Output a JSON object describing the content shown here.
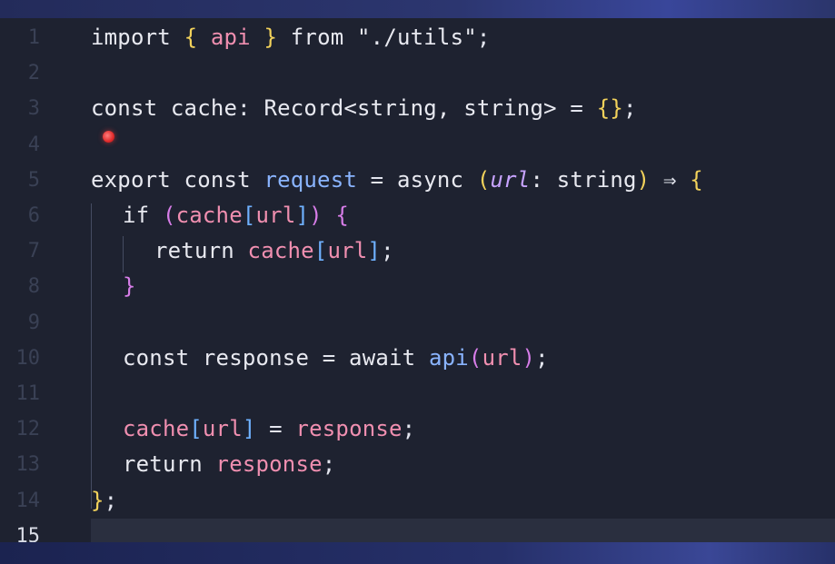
{
  "editor": {
    "current_line": "15",
    "lines": [
      {
        "number": "1",
        "tokens": [
          {
            "t": "import",
            "c": "kw"
          },
          {
            "t": " ",
            "c": "punct"
          },
          {
            "t": "{",
            "c": "bracket-y"
          },
          {
            "t": " api ",
            "c": "var"
          },
          {
            "t": "}",
            "c": "bracket-y"
          },
          {
            "t": " from ",
            "c": "kw"
          },
          {
            "t": "\"./utils\"",
            "c": "str"
          },
          {
            "t": ";",
            "c": "punct"
          }
        ]
      },
      {
        "number": "2",
        "tokens": []
      },
      {
        "number": "3",
        "tokens": [
          {
            "t": "const cache",
            "c": "kw"
          },
          {
            "t": ": ",
            "c": "punct"
          },
          {
            "t": "Record",
            "c": "type"
          },
          {
            "t": "<string, string>",
            "c": "type"
          },
          {
            "t": " = ",
            "c": "op"
          },
          {
            "t": "{}",
            "c": "bracket-y"
          },
          {
            "t": ";",
            "c": "punct"
          }
        ]
      },
      {
        "number": "4",
        "tokens": []
      },
      {
        "number": "5",
        "tokens": [
          {
            "t": "export const ",
            "c": "kw"
          },
          {
            "t": "request",
            "c": "fn"
          },
          {
            "t": " = ",
            "c": "op"
          },
          {
            "t": "async ",
            "c": "kw"
          },
          {
            "t": "(",
            "c": "bracket-y"
          },
          {
            "t": "url",
            "c": "param"
          },
          {
            "t": ": string",
            "c": "type"
          },
          {
            "t": ")",
            "c": "bracket-y"
          },
          {
            "t": " ⇒ ",
            "c": "op"
          },
          {
            "t": "{",
            "c": "bracket-y"
          }
        ]
      },
      {
        "number": "6",
        "tokens": [
          {
            "t": "if ",
            "c": "kw"
          },
          {
            "t": "(",
            "c": "bracket-p"
          },
          {
            "t": "cache",
            "c": "var"
          },
          {
            "t": "[",
            "c": "bracket-b"
          },
          {
            "t": "url",
            "c": "var"
          },
          {
            "t": "]",
            "c": "bracket-b"
          },
          {
            "t": ")",
            "c": "bracket-p"
          },
          {
            "t": " {",
            "c": "bracket-p"
          }
        ]
      },
      {
        "number": "7",
        "tokens": [
          {
            "t": "return ",
            "c": "kw"
          },
          {
            "t": "cache",
            "c": "var"
          },
          {
            "t": "[",
            "c": "bracket-b"
          },
          {
            "t": "url",
            "c": "var"
          },
          {
            "t": "]",
            "c": "bracket-b"
          },
          {
            "t": ";",
            "c": "punct"
          }
        ]
      },
      {
        "number": "8",
        "tokens": [
          {
            "t": "}",
            "c": "bracket-p"
          }
        ]
      },
      {
        "number": "9",
        "tokens": []
      },
      {
        "number": "10",
        "tokens": [
          {
            "t": "const response",
            "c": "kw"
          },
          {
            "t": " = ",
            "c": "op"
          },
          {
            "t": "await ",
            "c": "kw"
          },
          {
            "t": "api",
            "c": "fn"
          },
          {
            "t": "(",
            "c": "bracket-p"
          },
          {
            "t": "url",
            "c": "var"
          },
          {
            "t": ")",
            "c": "bracket-p"
          },
          {
            "t": ";",
            "c": "punct"
          }
        ]
      },
      {
        "number": "11",
        "tokens": []
      },
      {
        "number": "12",
        "tokens": [
          {
            "t": "cache",
            "c": "var"
          },
          {
            "t": "[",
            "c": "bracket-b"
          },
          {
            "t": "url",
            "c": "var"
          },
          {
            "t": "]",
            "c": "bracket-b"
          },
          {
            "t": " = ",
            "c": "op"
          },
          {
            "t": "response",
            "c": "var"
          },
          {
            "t": ";",
            "c": "punct"
          }
        ]
      },
      {
        "number": "13",
        "tokens": [
          {
            "t": "return ",
            "c": "kw"
          },
          {
            "t": "response",
            "c": "var"
          },
          {
            "t": ";",
            "c": "punct"
          }
        ]
      },
      {
        "number": "14",
        "tokens": [
          {
            "t": "}",
            "c": "bracket-y"
          },
          {
            "t": ";",
            "c": "punct"
          }
        ]
      },
      {
        "number": "15",
        "tokens": []
      }
    ]
  },
  "colors": {
    "keyword": "#e8e9f0",
    "variable": "#f08fb0",
    "function": "#8ab4ff",
    "parameter": "#c7a3ff",
    "bracket_yellow": "#f2d25b",
    "bracket_purple": "#d77de8",
    "bracket_blue": "#6fb1ff",
    "breakpoint": "#e02a2a"
  }
}
